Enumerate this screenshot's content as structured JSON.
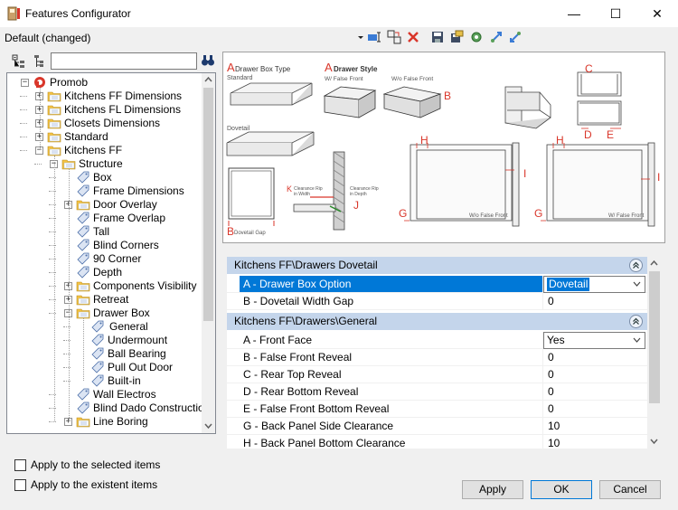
{
  "window": {
    "title": "Features Configurator",
    "minimize": "—",
    "maximize": "☐",
    "close": "✕"
  },
  "config": {
    "name": "Default (changed)"
  },
  "tree": {
    "items": [
      {
        "label": "Promob",
        "level": 0,
        "type": "root",
        "expander": "−"
      },
      {
        "label": "Kitchens FF Dimensions",
        "level": 1,
        "type": "folder",
        "expander": "+"
      },
      {
        "label": "Kitchens FL Dimensions",
        "level": 1,
        "type": "folder",
        "expander": "+"
      },
      {
        "label": "Closets Dimensions",
        "level": 1,
        "type": "folder",
        "expander": "+"
      },
      {
        "label": "Standard",
        "level": 1,
        "type": "folder",
        "expander": "+"
      },
      {
        "label": "Kitchens FF",
        "level": 1,
        "type": "folder",
        "expander": "−"
      },
      {
        "label": "Structure",
        "level": 2,
        "type": "folder",
        "expander": "−"
      },
      {
        "label": "Box",
        "level": 3,
        "type": "tag",
        "expander": ""
      },
      {
        "label": "Frame Dimensions",
        "level": 3,
        "type": "tag",
        "expander": ""
      },
      {
        "label": "Door Overlay",
        "level": 3,
        "type": "folder",
        "expander": "+"
      },
      {
        "label": "Frame Overlap",
        "level": 3,
        "type": "tag",
        "expander": ""
      },
      {
        "label": "Tall",
        "level": 3,
        "type": "tag",
        "expander": ""
      },
      {
        "label": "Blind Corners",
        "level": 3,
        "type": "tag",
        "expander": ""
      },
      {
        "label": "90 Corner",
        "level": 3,
        "type": "tag",
        "expander": ""
      },
      {
        "label": "Depth",
        "level": 3,
        "type": "tag",
        "expander": ""
      },
      {
        "label": "Components Visibility",
        "level": 3,
        "type": "folder",
        "expander": "+"
      },
      {
        "label": "Retreat",
        "level": 3,
        "type": "folder",
        "expander": "+"
      },
      {
        "label": "Drawer Box",
        "level": 3,
        "type": "folder",
        "expander": "−"
      },
      {
        "label": "General",
        "level": 4,
        "type": "tag",
        "expander": "",
        "selected": true
      },
      {
        "label": "Undermount",
        "level": 4,
        "type": "tag",
        "expander": ""
      },
      {
        "label": "Ball Bearing",
        "level": 4,
        "type": "tag",
        "expander": ""
      },
      {
        "label": "Pull Out Door",
        "level": 4,
        "type": "tag",
        "expander": ""
      },
      {
        "label": "Built-in",
        "level": 4,
        "type": "tag",
        "expander": ""
      },
      {
        "label": "Wall Electros",
        "level": 3,
        "type": "tag",
        "expander": ""
      },
      {
        "label": "Blind Dado Construction",
        "level": 3,
        "type": "tag",
        "expander": ""
      },
      {
        "label": "Line Boring",
        "level": 3,
        "type": "folder",
        "expander": "+"
      }
    ]
  },
  "diagram": {
    "box_type_letter": "A",
    "box_type_title": "Drawer Box Type",
    "standard": "Standard",
    "dovetail": "Dovetail",
    "dovetail_gap_letter": "B",
    "dovetail_gap": "Dovetail Gap",
    "style_letter": "A",
    "style_title": "Drawer Style",
    "wff": "W/ False Front",
    "wofront": "W/o False Front",
    "b_letter": "B",
    "c_letter": "C",
    "d_letter": "D",
    "e_letter": "E",
    "h1": "H",
    "h2": "H",
    "i1": "I",
    "i2": "I",
    "g1": "G",
    "g2": "G",
    "k_letter": "K",
    "j_letter": "J",
    "clearance_width_1": "Clearance Rip",
    "clearance_width_2": "in Width",
    "clearance_depth_1": "Clearance Rip",
    "clearance_depth_2": "in Depth",
    "wo_false_front": "W/o False Front",
    "w_false_front": "W/ False Front"
  },
  "groups": [
    {
      "title": "Kitchens FF\\Drawers Dovetail",
      "rows": [
        {
          "label": "A - Drawer Box Option",
          "value": "Dovetail",
          "combo": true,
          "selected": true
        },
        {
          "label": "B - Dovetail Width Gap",
          "value": "0"
        }
      ]
    },
    {
      "title": "Kitchens FF\\Drawers\\General",
      "rows": [
        {
          "label": "A - Front Face",
          "value": "Yes",
          "combo": true
        },
        {
          "label": "B - False Front Reveal",
          "value": "0"
        },
        {
          "label": "C - Rear Top Reveal",
          "value": "0"
        },
        {
          "label": "D - Rear Bottom Reveal",
          "value": "0"
        },
        {
          "label": "E - False Front Bottom Reveal",
          "value": "0"
        },
        {
          "label": "G - Back Panel Side Clearance",
          "value": "10"
        },
        {
          "label": "H - Back Panel Bottom Clearance",
          "value": "10"
        }
      ]
    }
  ],
  "options": {
    "apply_selected": "Apply to the selected items",
    "apply_existent": "Apply to the existent items"
  },
  "buttons": {
    "apply": "Apply",
    "ok": "OK",
    "cancel": "Cancel"
  },
  "colors": {
    "accent": "#0078d7",
    "group_header": "#c4d5eb",
    "red_label": "#d9362a",
    "folder": "#f5c343"
  }
}
